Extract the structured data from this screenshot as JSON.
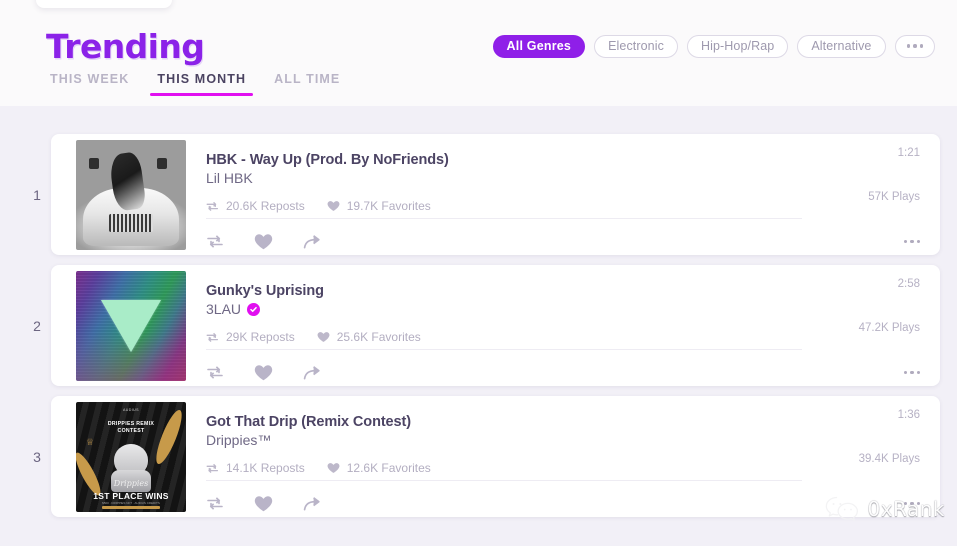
{
  "header": {
    "title": "Trending",
    "tabs": [
      {
        "label": "THIS WEEK",
        "active": false
      },
      {
        "label": "THIS MONTH",
        "active": true
      },
      {
        "label": "ALL TIME",
        "active": false
      }
    ],
    "genres": [
      {
        "label": "All Genres",
        "active": true
      },
      {
        "label": "Electronic",
        "active": false
      },
      {
        "label": "Hip-Hop/Rap",
        "active": false
      },
      {
        "label": "Alternative",
        "active": false
      }
    ],
    "more_genres_label": "",
    "accent_color": "#8f1fe8",
    "active_tab_underline_color": "#e10ff0",
    "title_color": "#8b22e8"
  },
  "tracks": [
    {
      "rank": "1",
      "title": "HBK - Way Up (Prod. By NoFriends)",
      "artist": "Lil HBK",
      "verified": false,
      "reposts": "20.6K Reposts",
      "favorites": "19.7K Favorites",
      "duration": "1:21",
      "plays": "57K Plays"
    },
    {
      "rank": "2",
      "title": "Gunky's Uprising",
      "artist": "3LAU",
      "verified": true,
      "reposts": "29K Reposts",
      "favorites": "25.6K Favorites",
      "duration": "2:58",
      "plays": "47.2K Plays"
    },
    {
      "rank": "3",
      "title": "Got That Drip (Remix Contest)",
      "artist": "Drippies™",
      "verified": false,
      "reposts": "14.1K Reposts",
      "favorites": "12.6K Favorites",
      "duration": "1:36",
      "plays": "39.4K Plays"
    }
  ],
  "artwork": {
    "track3": {
      "brand": "AUDIUS",
      "contest_line1": "DRIPPIES REMIX",
      "contest_line2": "CONTEST",
      "script": "Drippies",
      "prize": "1ST PLACE WINS",
      "fineprint": "$500 · DRIPPIES NFT · AUDIUS CREDITS"
    }
  },
  "watermark": {
    "text": "0xRank",
    "icon": "wechat-icon"
  }
}
